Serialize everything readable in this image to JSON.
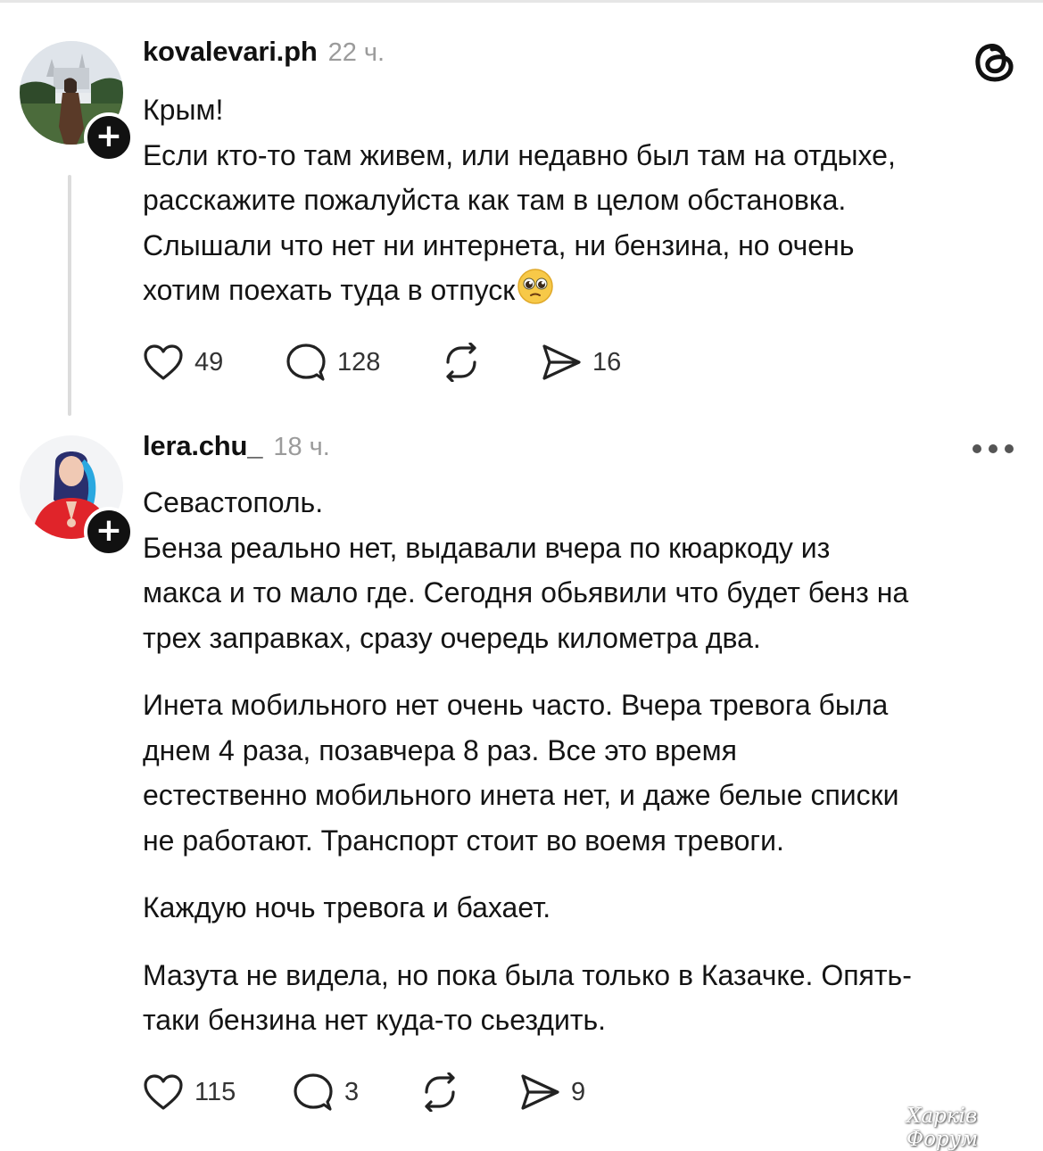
{
  "posts": [
    {
      "username": "kovalevari.ph",
      "time": "22 ч.",
      "paragraphs": [
        [
          "Крым!"
        ],
        [
          "Если кто-то там живем, или недавно был там на отдыхе,",
          "расскажите пожалуйста как там в целом обстановка.",
          "Слышали что нет ни интернета, ни бензина, но очень",
          "хотим поехать туда в отпуск"
        ]
      ],
      "emoji": "pleading-face-emoji",
      "likes": "49",
      "replies": "128",
      "shares": "16"
    },
    {
      "username": "lera.chu_",
      "time": "18 ч.",
      "paragraphs": [
        [
          "Севастополь."
        ],
        [
          "Бенза реально нет, выдавали вчера по кюаркоду из",
          "макса и то мало где. Сегодня обьявили что будет бенз на",
          "трех заправках, сразу очередь километра два."
        ],
        [
          "Инета мобильного нет очень часто. Вчера тревога была",
          "днем 4 раза, позавчера 8 раз. Все это время",
          "естественно мобильного инета нет, и даже белые списки",
          "не работают. Транспорт стоит во воемя тревоги."
        ],
        [
          "Каждую ночь тревога и бахает."
        ],
        [
          "Мазута не видела, но пока была только в Казачке. Опять-",
          "таки бензина нет куда-то сьездить."
        ]
      ],
      "likes": "115",
      "replies": "3",
      "shares": "9"
    }
  ],
  "watermark": "Харків Форум",
  "icons": {
    "logo": "threads-logo-icon",
    "more": "more-dots-icon",
    "like": "heart-icon",
    "reply": "comment-bubble-icon",
    "repost": "repost-icon",
    "share": "send-icon",
    "follow": "plus-icon"
  },
  "colors": {
    "text": "#141414",
    "muted": "#9b9b9b",
    "thread_line": "#dcdcdc"
  }
}
